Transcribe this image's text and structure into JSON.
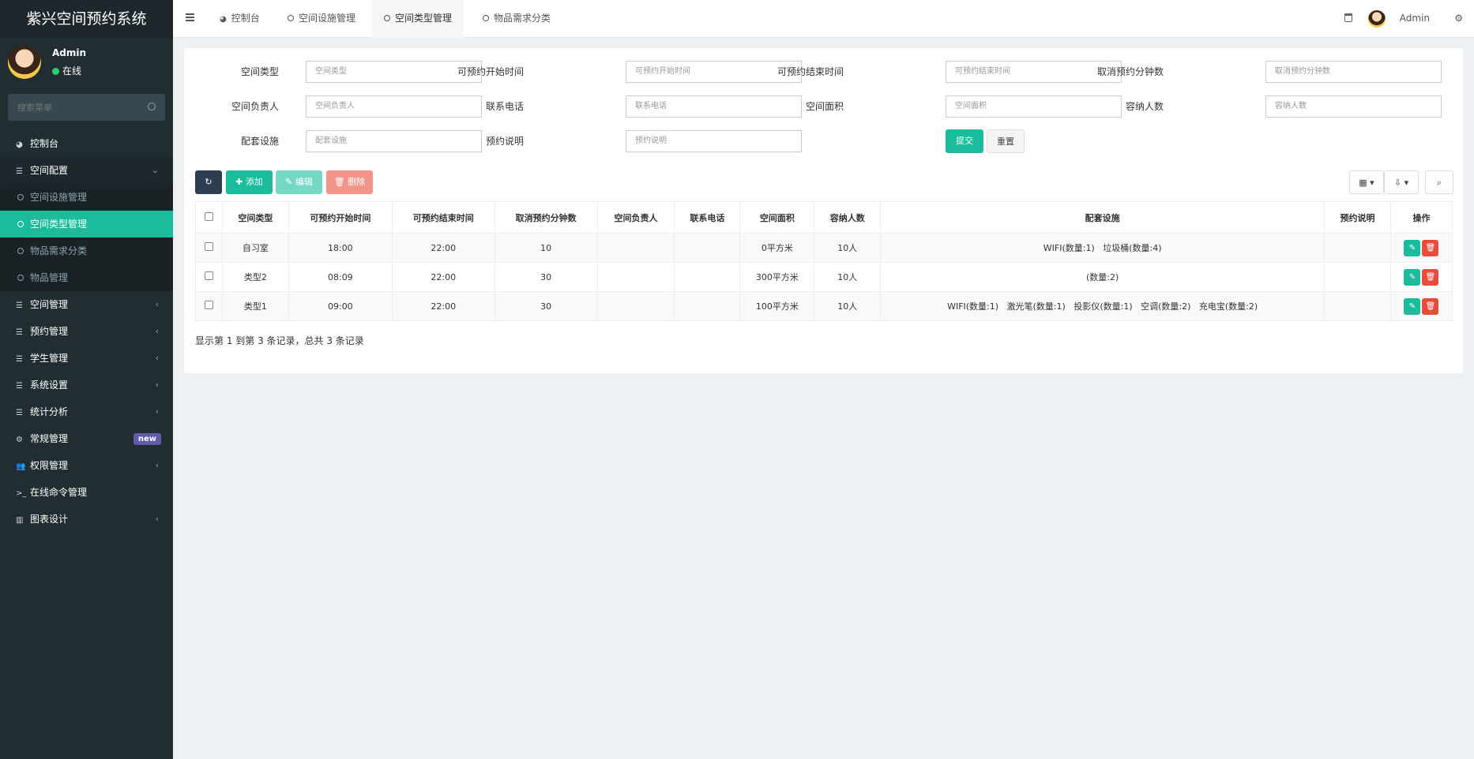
{
  "app": {
    "title": "紫兴空间预约系统"
  },
  "user": {
    "name": "Admin",
    "status": "在线"
  },
  "search": {
    "placeholder": "搜索菜单"
  },
  "menu": [
    {
      "label": "控制台",
      "icon": "dashboard-icon"
    },
    {
      "label": "空间配置",
      "icon": "list-icon",
      "expanded": true
    },
    {
      "label": "空间设施管理",
      "sub": true
    },
    {
      "label": "空间类型管理",
      "sub": true,
      "active": true
    },
    {
      "label": "物品需求分类",
      "sub": true
    },
    {
      "label": "物品管理",
      "sub": true
    },
    {
      "label": "空间管理",
      "icon": "list-icon"
    },
    {
      "label": "预约管理",
      "icon": "list-icon"
    },
    {
      "label": "学生管理",
      "icon": "list-icon"
    },
    {
      "label": "系统设置",
      "icon": "list-icon"
    },
    {
      "label": "统计分析",
      "icon": "list-icon"
    },
    {
      "label": "常规管理",
      "icon": "gears-icon",
      "badge": "new"
    },
    {
      "label": "权限管理",
      "icon": "users-icon"
    },
    {
      "label": "在线命令管理",
      "icon": "terminal-icon"
    },
    {
      "label": "图表设计",
      "icon": "bar-chart-icon"
    }
  ],
  "tabs": [
    {
      "label": "控制台"
    },
    {
      "label": "空间设施管理"
    },
    {
      "label": "空间类型管理",
      "active": true
    },
    {
      "label": "物品需求分类"
    }
  ],
  "topright": {
    "username": "Admin"
  },
  "form": {
    "fields": [
      {
        "label": "空间类型",
        "placeholder": "空间类型"
      },
      {
        "label": "可预约开始时间",
        "placeholder": "可预约开始时间"
      },
      {
        "label": "可预约结束时间",
        "placeholder": "可预约结束时间"
      },
      {
        "label": "取消预约分钟数",
        "placeholder": "取消预约分钟数"
      },
      {
        "label": "空间负责人",
        "placeholder": "空间负责人"
      },
      {
        "label": "联系电话",
        "placeholder": "联系电话"
      },
      {
        "label": "空间面积",
        "placeholder": "空间面积"
      },
      {
        "label": "容纳人数",
        "placeholder": "容纳人数"
      },
      {
        "label": "配套设施",
        "placeholder": "配套设施"
      },
      {
        "label": "预约说明",
        "placeholder": "预约说明"
      }
    ],
    "submit": "提交",
    "reset": "重置"
  },
  "toolbar": {
    "add": "添加",
    "edit": "编辑",
    "delete": "删除"
  },
  "table": {
    "columns": [
      "空间类型",
      "可预约开始时间",
      "可预约结束时间",
      "取消预约分钟数",
      "空间负责人",
      "联系电话",
      "空间面积",
      "容纳人数",
      "配套设施",
      "预约说明",
      "操作"
    ],
    "rows": [
      [
        "自习室",
        "18:00",
        "22:00",
        "10",
        "",
        "",
        "0平方米",
        "10人",
        "WIFI(数量:1)   垃圾桶(数量:4)",
        ""
      ],
      [
        "类型2",
        "08:09",
        "22:00",
        "30",
        "",
        "",
        "300平方米",
        "10人",
        "(数量:2)",
        ""
      ],
      [
        "类型1",
        "09:00",
        "22:00",
        "30",
        "",
        "",
        "100平方米",
        "10人",
        "WIFI(数量:1)   激光笔(数量:1)   投影仪(数量:1)   空调(数量:2)   充电宝(数量:2)",
        ""
      ]
    ]
  },
  "pagination": {
    "info": "显示第 1 到第 3 条记录，总共 3 条记录"
  },
  "colors": {
    "sidebar": "#222d32",
    "accent": "#1abc9c",
    "danger": "#e74c3c",
    "dark": "#2c3e50"
  }
}
